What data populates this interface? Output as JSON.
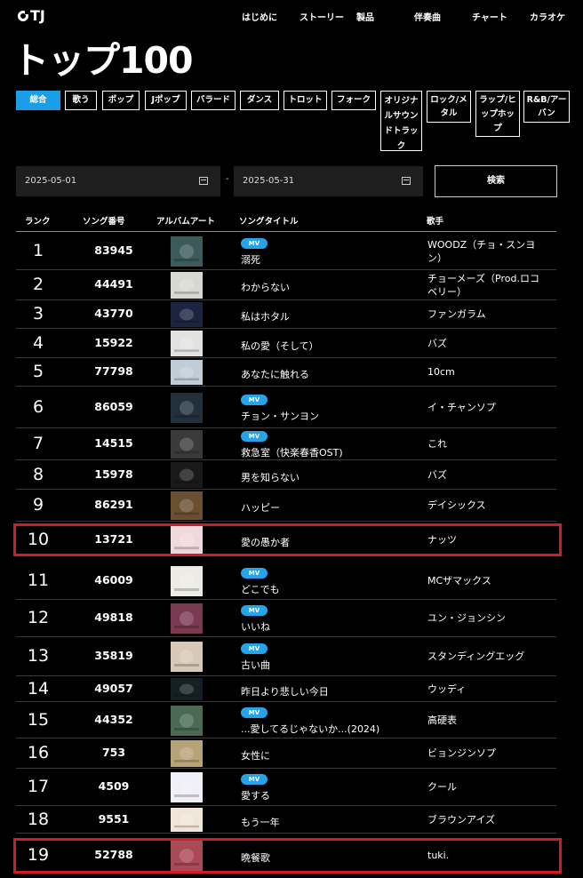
{
  "brand": {
    "logo_text": "TJ"
  },
  "nav": [
    "はじめに",
    "ストーリー",
    "製品",
    "伴奏曲",
    "チャート",
    "カラオケ"
  ],
  "page_title": "トップ100",
  "filters": [
    {
      "label": "総合",
      "active": true
    },
    {
      "label": "歌う",
      "active": false
    },
    {
      "label": "ポップ",
      "active": false
    },
    {
      "label": "Jポップ",
      "active": false
    },
    {
      "label": "バラード",
      "active": false
    },
    {
      "label": "ダンス",
      "active": false
    },
    {
      "label": "トロット",
      "active": false
    },
    {
      "label": "フォーク",
      "active": false
    },
    {
      "label": "オリジナルサウンドトラック",
      "active": false
    },
    {
      "label": "ロック/メタル",
      "active": false
    },
    {
      "label": "ラップ/ヒップホップ",
      "active": false
    },
    {
      "label": "R&B/アーバン",
      "active": false
    }
  ],
  "date_range": {
    "start": "2025-05-01",
    "end": "2025-05-31",
    "separator": "-"
  },
  "search_label": "検索",
  "columns": {
    "rank": "ランク",
    "song_number": "ソング番号",
    "album_art": "アルバムアート",
    "song_title": "ソングタイトル",
    "artist": "歌手"
  },
  "mv_badge": "MV",
  "songs": [
    {
      "rank": "1",
      "number": "83945",
      "title": "溺死",
      "artist": "WOODZ（チョ・スンヨン）",
      "mv": true,
      "highlighted": false,
      "art_color": "#3d5a5a"
    },
    {
      "rank": "2",
      "number": "44491",
      "title": "わからない",
      "artist": "チョーメーズ（Prod.ロコベリー）",
      "mv": false,
      "highlighted": false,
      "art_color": "#d8d8d2"
    },
    {
      "rank": "3",
      "number": "43770",
      "title": "私はホタル",
      "artist": "ファンガラム",
      "mv": false,
      "highlighted": false,
      "art_color": "#1c2540"
    },
    {
      "rank": "4",
      "number": "15922",
      "title": "私の愛（そして）",
      "artist": "バズ",
      "mv": false,
      "highlighted": false,
      "art_color": "#e2e2e2"
    },
    {
      "rank": "5",
      "number": "77798",
      "title": "あなたに触れる",
      "artist": "10cm",
      "mv": false,
      "highlighted": false,
      "art_color": "#c0ccd6"
    },
    {
      "rank": "6",
      "number": "86059",
      "title": "チョン・サンヨン",
      "artist": "イ・チャンソプ",
      "mv": true,
      "highlighted": false,
      "art_color": "#22303c"
    },
    {
      "rank": "7",
      "number": "14515",
      "title": "救急室（快楽春香OST)",
      "artist": "これ",
      "mv": true,
      "highlighted": false,
      "art_color": "#3a3a3a"
    },
    {
      "rank": "8",
      "number": "15978",
      "title": "男を知らない",
      "artist": "バズ",
      "mv": false,
      "highlighted": false,
      "art_color": "#1a1a1a"
    },
    {
      "rank": "9",
      "number": "86291",
      "title": "ハッピー",
      "artist": "デイシックス",
      "mv": false,
      "highlighted": false,
      "art_color": "#6a5030"
    },
    {
      "rank": "10",
      "number": "13721",
      "title": "愛の愚か者",
      "artist": "ナッツ",
      "mv": false,
      "highlighted": true,
      "art_color": "#f0d8de"
    },
    {
      "rank": "11",
      "number": "46009",
      "title": "どこでも",
      "artist": "MCザマックス",
      "mv": true,
      "highlighted": false,
      "art_color": "#ecebe6"
    },
    {
      "rank": "12",
      "number": "49818",
      "title": "いいね",
      "artist": "ユン・ジョンシン",
      "mv": true,
      "highlighted": false,
      "art_color": "#7a3a52"
    },
    {
      "rank": "13",
      "number": "35819",
      "title": "古い曲",
      "artist": "スタンディングエッグ",
      "mv": true,
      "highlighted": false,
      "art_color": "#d8c8b6"
    },
    {
      "rank": "14",
      "number": "49057",
      "title": "昨日より悲しい今日",
      "artist": "ウッディ",
      "mv": false,
      "highlighted": false,
      "art_color": "#142024"
    },
    {
      "rank": "15",
      "number": "44352",
      "title": "...愛してるじゃないか...(2024)",
      "artist": "高硬表",
      "mv": true,
      "highlighted": false,
      "art_color": "#4a6a56"
    },
    {
      "rank": "16",
      "number": "753",
      "title": "女性に",
      "artist": "ビョンジンソプ",
      "mv": false,
      "highlighted": false,
      "art_color": "#b8a278"
    },
    {
      "rank": "17",
      "number": "4509",
      "title": "愛する",
      "artist": "クール",
      "mv": true,
      "highlighted": false,
      "art_color": "#f0eef6"
    },
    {
      "rank": "18",
      "number": "9551",
      "title": "もう一年",
      "artist": "ブラウンアイズ",
      "mv": false,
      "highlighted": false,
      "art_color": "#f0e6d8"
    },
    {
      "rank": "19",
      "number": "52788",
      "title": "晩餐歌",
      "artist": "tuki.",
      "mv": false,
      "highlighted": true,
      "art_color": "#a84a58"
    }
  ]
}
